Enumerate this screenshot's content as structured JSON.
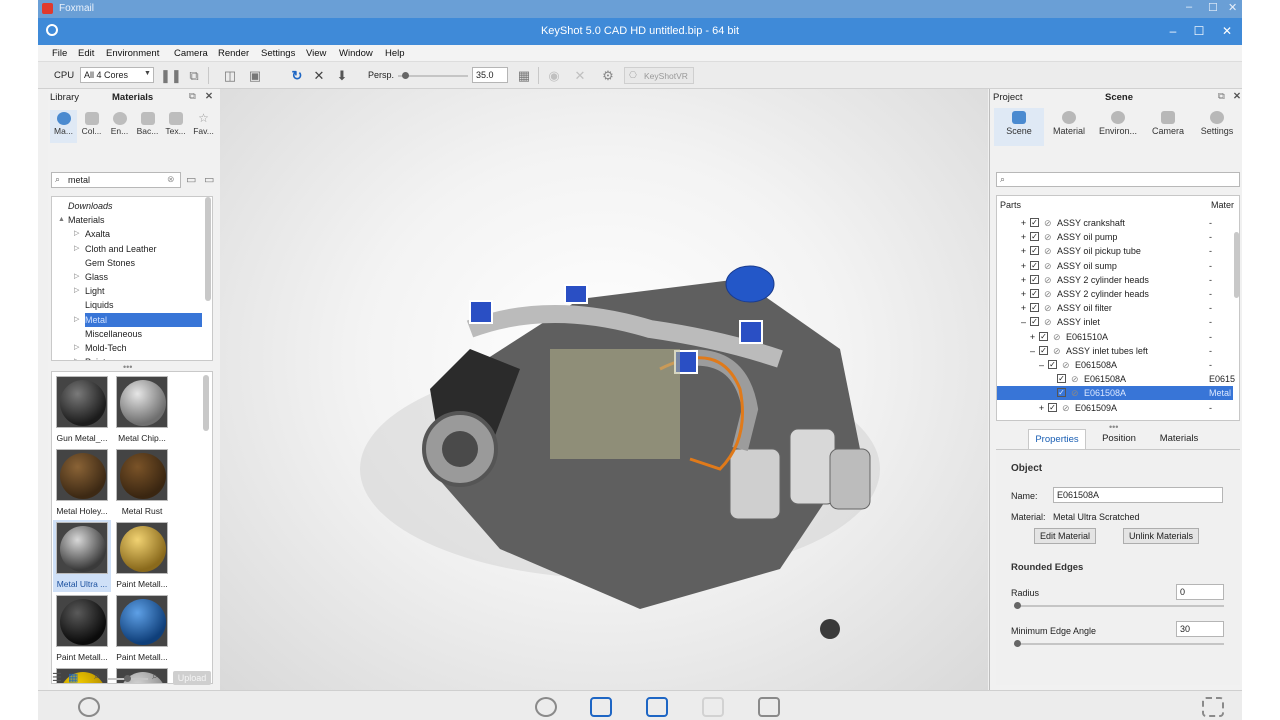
{
  "host_window": {
    "title": "Foxmail"
  },
  "window": {
    "title": "KeyShot 5.0 CAD HD   untitled.bip  - 64 bit",
    "controls": {
      "minimize": "–",
      "maximize": "☐",
      "close": "✕"
    }
  },
  "menu": [
    "File",
    "Edit",
    "Environment",
    "Camera",
    "Render",
    "Settings",
    "View",
    "Window",
    "Help"
  ],
  "toolbar": {
    "cpu_label": "CPU",
    "cores_value": "All 4 Cores",
    "persp_label": "Persp.",
    "fov_value": "35.0",
    "fov_level": 0.1,
    "keyshotvr_label": "KeyShotVR"
  },
  "library": {
    "tab_library": "Library",
    "tab_materials": "Materials",
    "category_tabs": [
      "Ma...",
      "Col...",
      "En...",
      "Bac...",
      "Tex...",
      "Fav..."
    ],
    "search_value": "metal",
    "tree": [
      {
        "label": "Downloads",
        "indent": 0,
        "expander": ""
      },
      {
        "label": "Materials",
        "indent": 0,
        "expander": "▲"
      },
      {
        "label": "Axalta",
        "indent": 1,
        "expander": "▷"
      },
      {
        "label": "Cloth and Leather",
        "indent": 1,
        "expander": "▷"
      },
      {
        "label": "Gem Stones",
        "indent": 1,
        "expander": ""
      },
      {
        "label": "Glass",
        "indent": 1,
        "expander": "▷"
      },
      {
        "label": "Light",
        "indent": 1,
        "expander": "▷"
      },
      {
        "label": "Liquids",
        "indent": 1,
        "expander": ""
      },
      {
        "label": "Metal",
        "indent": 1,
        "expander": "▷",
        "selected": true
      },
      {
        "label": "Miscellaneous",
        "indent": 1,
        "expander": ""
      },
      {
        "label": "Mold-Tech",
        "indent": 1,
        "expander": "▷"
      },
      {
        "label": "Paint",
        "indent": 1,
        "expander": "▷"
      }
    ],
    "thumbnails": [
      {
        "label": "Gun Metal_...",
        "color": "#1c1c1c",
        "highlight": "#7a7a7a"
      },
      {
        "label": "Metal Chip...",
        "color": "#6f6f6f",
        "highlight": "#e6e6e6"
      },
      {
        "label": "Metal Holey...",
        "color": "#3d2914",
        "highlight": "#8a6336"
      },
      {
        "label": "Metal Rust",
        "color": "#3a2611",
        "highlight": "#7a5328"
      },
      {
        "label": "Metal Ultra ...",
        "color": "#3a3a3a",
        "highlight": "#d8d8d8",
        "selected": true
      },
      {
        "label": "Paint Metall...",
        "color": "#8a6a1c",
        "highlight": "#f1d272"
      },
      {
        "label": "Paint Metall...",
        "color": "#0b0b0b",
        "highlight": "#5a5a5a"
      },
      {
        "label": "Paint Metall...",
        "color": "#0f3f7a",
        "highlight": "#5ea0e6"
      },
      {
        "label": "",
        "color": "#b08800",
        "highlight": "#f5d000"
      },
      {
        "label": "",
        "color": "#8a8a8a",
        "highlight": "#d5d5d5"
      }
    ],
    "upload_label": "Upload"
  },
  "project": {
    "tab_project": "Project",
    "tab_scene": "Scene",
    "subtabs": [
      "Scene",
      "Material",
      "Environ...",
      "Camera",
      "Settings"
    ],
    "tree_headers": {
      "parts": "Parts",
      "material": "Mater"
    },
    "parts": [
      {
        "label": "ASSY crankshaft",
        "indent": 0,
        "expander": "+",
        "mat": "-"
      },
      {
        "label": "ASSY oil pump",
        "indent": 0,
        "expander": "+",
        "mat": "-"
      },
      {
        "label": "ASSY oil pickup tube",
        "indent": 0,
        "expander": "+",
        "mat": "-"
      },
      {
        "label": "ASSY oil sump",
        "indent": 0,
        "expander": "+",
        "mat": "-"
      },
      {
        "label": "ASSY 2 cylinder heads",
        "indent": 0,
        "expander": "+",
        "mat": "-"
      },
      {
        "label": "ASSY 2 cylinder heads",
        "indent": 0,
        "expander": "+",
        "mat": "-"
      },
      {
        "label": "ASSY oil filter",
        "indent": 0,
        "expander": "+",
        "mat": "-"
      },
      {
        "label": "ASSY inlet",
        "indent": 0,
        "expander": "–",
        "mat": "-"
      },
      {
        "label": "E061510A",
        "indent": 1,
        "expander": "+",
        "mat": "-"
      },
      {
        "label": "ASSY inlet tubes left",
        "indent": 1,
        "expander": "–",
        "mat": "-"
      },
      {
        "label": "E061508A",
        "indent": 2,
        "expander": "–",
        "mat": "-"
      },
      {
        "label": "E061508A",
        "indent": 3,
        "expander": "",
        "mat": "E0615"
      },
      {
        "label": "E061508A",
        "indent": 3,
        "expander": "",
        "mat": "Metal",
        "selected": true
      },
      {
        "label": "E061509A",
        "indent": 2,
        "expander": "+",
        "mat": "-"
      }
    ],
    "prop_tabs": [
      "Properties",
      "Position",
      "Materials"
    ],
    "object_heading": "Object",
    "name_label": "Name:",
    "name_value": "E061508A",
    "material_label": "Material:",
    "material_value": "Metal Ultra Scratched",
    "edit_material": "Edit Material",
    "unlink_materials": "Unlink Materials",
    "rounded_heading": "Rounded Edges",
    "radius_label": "Radius",
    "radius_value": "0",
    "min_angle_label": "Minimum Edge Angle",
    "min_angle_value": "30"
  }
}
